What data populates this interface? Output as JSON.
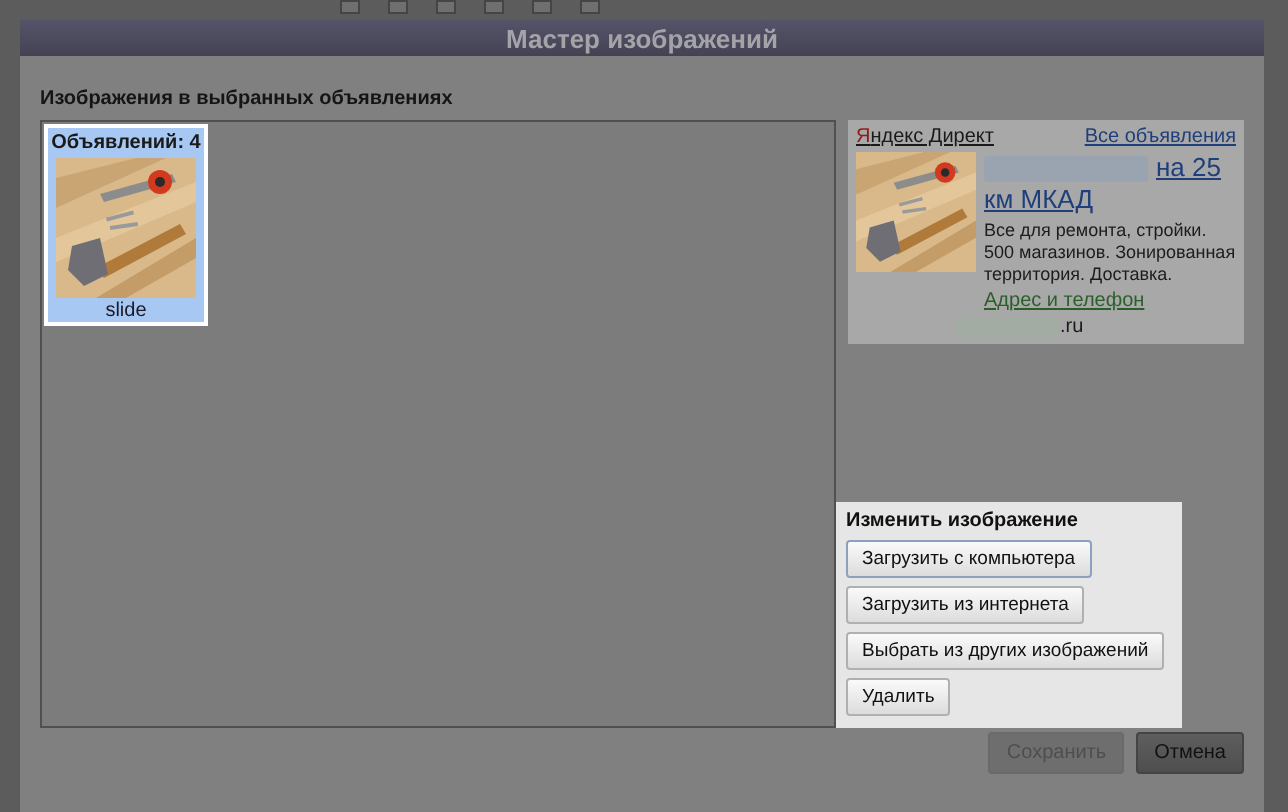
{
  "window": {
    "title": "Мастер изображений"
  },
  "section_title": "Изображения в выбранных объявлениях",
  "images": [
    {
      "count_label": "Объявлений: 4",
      "caption": "slide",
      "selected": true
    }
  ],
  "ad_preview": {
    "source": "Яндекс Директ",
    "all_ads_link": "Все объявления",
    "title": "на 25 км МКАД",
    "text": "Все для ремонта, стройки. 500 магазинов. Зонированная территория. Доставка.",
    "contacts_link": "Адрес и телефон",
    "domain": ".ru"
  },
  "change_panel": {
    "title": "Изменить изображение",
    "buttons": [
      "Загрузить с компьютера",
      "Загрузить из интернета",
      "Выбрать из других изображений",
      "Удалить"
    ]
  },
  "footer_buttons": [
    {
      "label": "Сохранить",
      "disabled": true
    },
    {
      "label": "Отмена",
      "disabled": false
    }
  ]
}
